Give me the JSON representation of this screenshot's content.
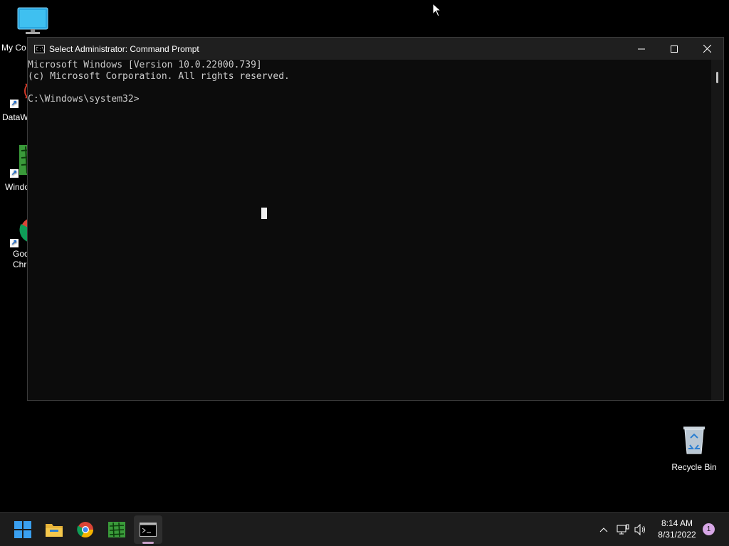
{
  "desktop": {
    "icons": [
      {
        "label": "My Co"
      },
      {
        "label": "DataW"
      },
      {
        "label": "Windo"
      },
      {
        "label": "Goo\nChr"
      },
      {
        "label": "Recycle Bin"
      }
    ]
  },
  "window": {
    "title": "Select Administrator: Command Prompt",
    "lines": [
      "Microsoft Windows [Version 10.0.22000.739]",
      "(c) Microsoft Corporation. All rights reserved.",
      "",
      "C:\\Windows\\system32>"
    ],
    "colors": {
      "console_bg": "#0c0c0c",
      "console_text": "#cccccc",
      "titlebar_bg": "#1f1f1f"
    }
  },
  "taskbar": {
    "apps": [
      "start-icon",
      "file-explorer-icon",
      "chrome-icon",
      "spreadsheet-app-icon",
      "command-prompt-icon"
    ],
    "clock_time": "8:14 AM",
    "clock_date": "8/31/2022",
    "notification_count": "1",
    "accent": "#c9a1c9"
  }
}
